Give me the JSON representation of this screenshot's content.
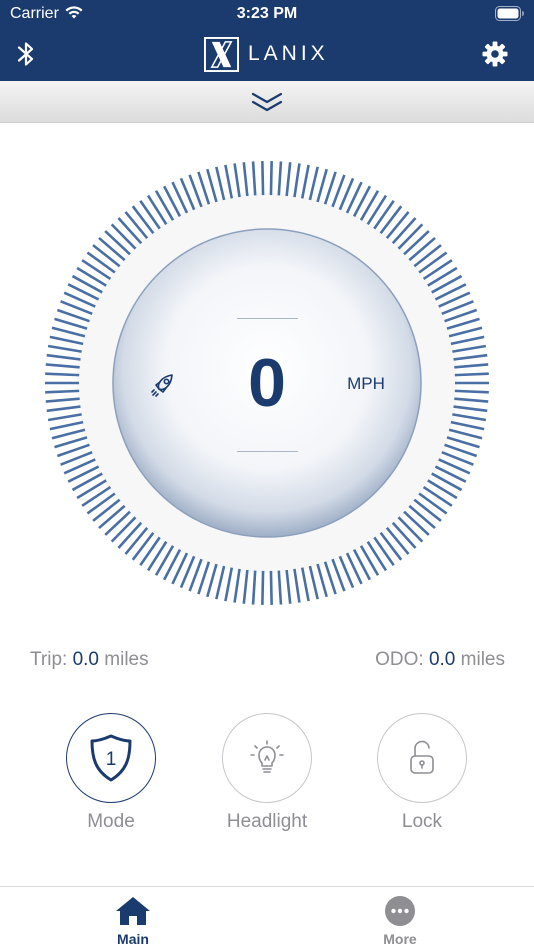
{
  "status_bar": {
    "carrier": "Carrier",
    "time": "3:23 PM"
  },
  "nav": {
    "brand": "LANIX",
    "left_icon": "bluetooth-icon",
    "right_icon": "gear-icon"
  },
  "pull_down": {
    "icon": "chevron-down-icon"
  },
  "gauge": {
    "speed": "0",
    "unit": "MPH",
    "mode_icon": "rocket-icon"
  },
  "stats": {
    "trip_label": "Trip:",
    "trip_value": "0.0",
    "trip_unit": "miles",
    "odo_label": "ODO:",
    "odo_value": "0.0",
    "odo_unit": "miles"
  },
  "controls": [
    {
      "label": "Mode",
      "icon": "shield-icon",
      "badge": "1",
      "active": true
    },
    {
      "label": "Headlight",
      "icon": "lightbulb-icon",
      "active": false
    },
    {
      "label": "Lock",
      "icon": "unlock-icon",
      "active": false
    }
  ],
  "tabs": [
    {
      "label": "Main",
      "icon": "home-icon",
      "selected": true
    },
    {
      "label": "More",
      "icon": "more-icon",
      "selected": false
    }
  ],
  "colors": {
    "brand_navy": "#1b3b6f",
    "tick_blue": "#4a6fa5",
    "gray_text": "#8e8e93"
  }
}
